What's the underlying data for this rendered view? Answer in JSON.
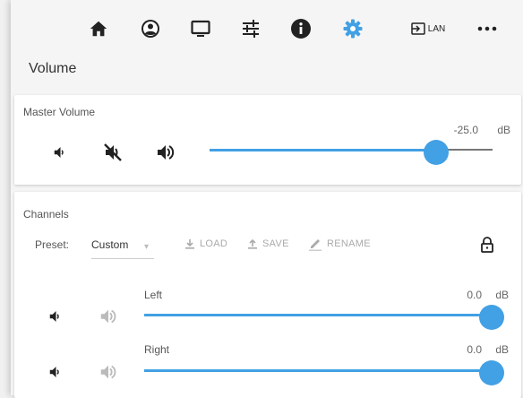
{
  "nav": {
    "lan_label": "LAN",
    "active": "settings"
  },
  "title": "Volume",
  "master": {
    "title": "Master Volume",
    "value_text": "-25.0",
    "unit": "dB",
    "level": 0.8
  },
  "channels": {
    "title": "Channels",
    "preset_label": "Preset:",
    "preset_value": "Custom",
    "load_label": "LOAD",
    "save_label": "SAVE",
    "rename_label": "RENAME",
    "items": [
      {
        "label": "Left",
        "value_text": "0.0",
        "unit": "dB",
        "level": 1.0
      },
      {
        "label": "Right",
        "value_text": "0.0",
        "unit": "dB",
        "level": 1.0
      }
    ]
  },
  "colors": {
    "accent": "#42a0e4",
    "icon": "#222222",
    "muted": "#aaaaaa"
  }
}
